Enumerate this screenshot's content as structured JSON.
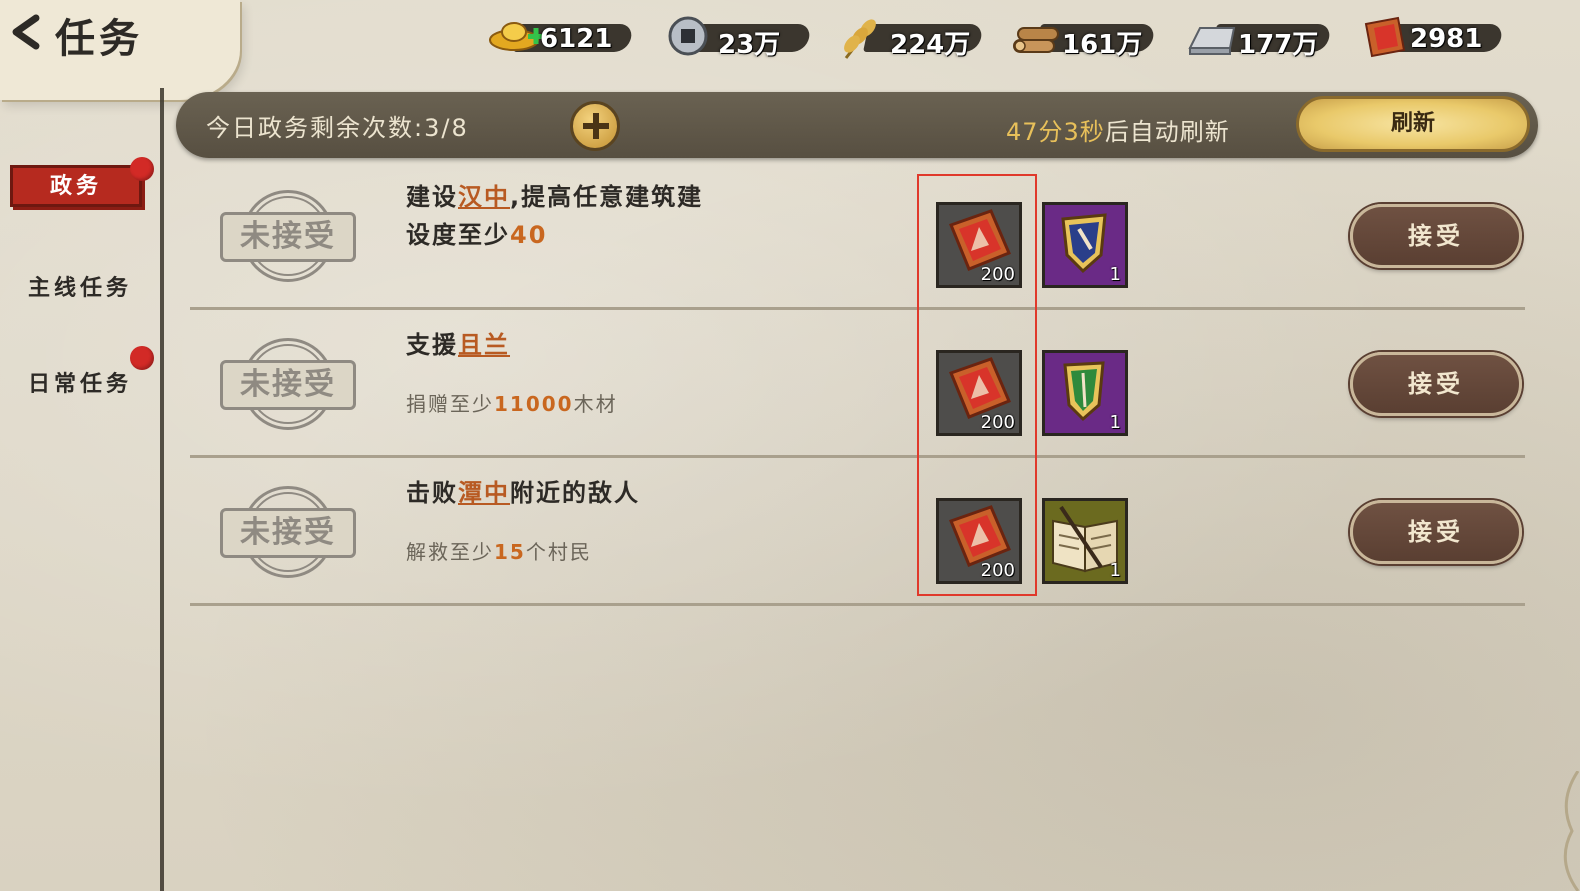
{
  "header": {
    "title": "任务",
    "back_icon": "back-arrow-icon"
  },
  "resources": [
    {
      "icon": "gold-ingot-icon",
      "value": "6121"
    },
    {
      "icon": "copper-coin-icon",
      "value": "23万"
    },
    {
      "icon": "wheat-icon",
      "value": "224万"
    },
    {
      "icon": "wood-logs-icon",
      "value": "161万"
    },
    {
      "icon": "iron-ingot-icon",
      "value": "177万"
    },
    {
      "icon": "merit-badge-icon",
      "value": "2981"
    }
  ],
  "info_bar": {
    "remaining_label": "今日政务剩余次数:3/8",
    "countdown_time": "47分3秒",
    "countdown_suffix": "后自动刷新",
    "refresh_label": "刷新"
  },
  "sidebar": {
    "items": [
      {
        "label": "政务",
        "active": true,
        "badge": true
      },
      {
        "label": "主线任务",
        "active": false,
        "badge": false
      },
      {
        "label": "日常任务",
        "active": false,
        "badge": true
      }
    ]
  },
  "tasks": [
    {
      "status": "未接受",
      "desc_pre": "建设",
      "location": "汉中",
      "desc_post": ",提高任意建筑建",
      "line2_pre": "设度至少",
      "line2_num": "40",
      "sub_pre": "",
      "sub_num": "",
      "sub_post": "",
      "rewards": [
        {
          "icon": "merit-badge-icon",
          "count": "200"
        },
        {
          "icon": "purple-banner-icon",
          "count": "1",
          "color": "#6a2a86"
        }
      ],
      "accept_label": "接受"
    },
    {
      "status": "未接受",
      "desc_pre": "支援",
      "location": "且兰",
      "desc_post": "",
      "line2_pre": "",
      "line2_num": "",
      "sub_pre": "捐赠至少",
      "sub_num": "11000",
      "sub_post": "木材",
      "rewards": [
        {
          "icon": "merit-badge-icon",
          "count": "200"
        },
        {
          "icon": "green-banner-icon",
          "count": "1",
          "color": "#6a2a86"
        }
      ],
      "accept_label": "接受"
    },
    {
      "status": "未接受",
      "desc_pre": "击败",
      "location": "潭中",
      "desc_post": "附近的敌人",
      "line2_pre": "",
      "line2_num": "",
      "sub_pre": "解救至少",
      "sub_num": "15",
      "sub_post": "个村民",
      "rewards": [
        {
          "icon": "merit-badge-icon",
          "count": "200"
        },
        {
          "icon": "book-icon",
          "count": "1",
          "color": "#6b6a1f"
        }
      ],
      "accept_label": "接受"
    }
  ],
  "colors": {
    "accent_red": "#b62a1f",
    "highlight_box": "#e0392b",
    "location_link": "#b85a22",
    "number": "#c9671f"
  }
}
